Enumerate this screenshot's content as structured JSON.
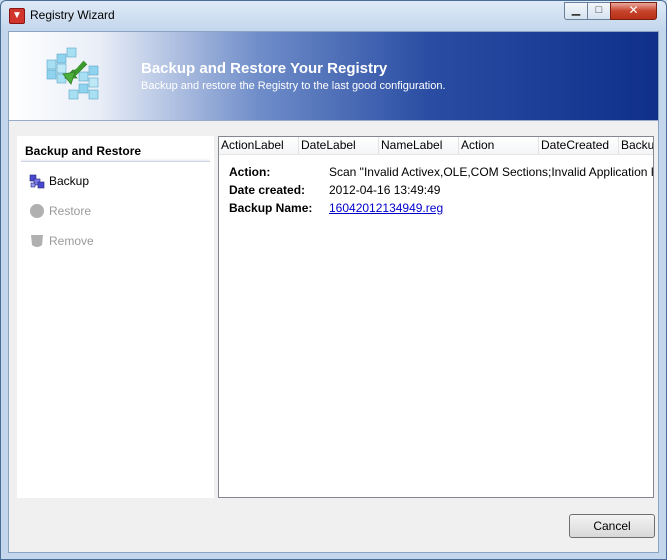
{
  "window": {
    "title": "Registry Wizard",
    "close_glyph": "✕",
    "min_glyph": "▁",
    "max_glyph": "□"
  },
  "banner": {
    "title": "Backup and Restore Your Registry",
    "subtitle": "Backup and restore the Registry to the last good configuration."
  },
  "sidebar": {
    "header": "Backup and Restore",
    "items": [
      {
        "label": "Backup",
        "icon": "backup-cubes-icon",
        "enabled": true
      },
      {
        "label": "Restore",
        "icon": "restore-icon",
        "enabled": false
      },
      {
        "label": "Remove",
        "icon": "remove-icon",
        "enabled": false
      }
    ]
  },
  "table": {
    "columns": [
      "ActionLabel",
      "DateLabel",
      "NameLabel",
      "Action",
      "DateCreated",
      "BackupName"
    ]
  },
  "details": {
    "action_label": "Action:",
    "action_value": "Scan \"Invalid Activex,OLE,COM Sections;Invalid Application Folders",
    "date_label": "Date created:",
    "date_value": "2012-04-16 13:49:49",
    "name_label": "Backup Name:",
    "name_value": "16042012134949.reg"
  },
  "footer": {
    "cancel_label": "Cancel"
  },
  "colors": {
    "banner_dark": "#0f2f8a",
    "link": "#0000cc",
    "disabled_text": "#9a9a9a"
  }
}
